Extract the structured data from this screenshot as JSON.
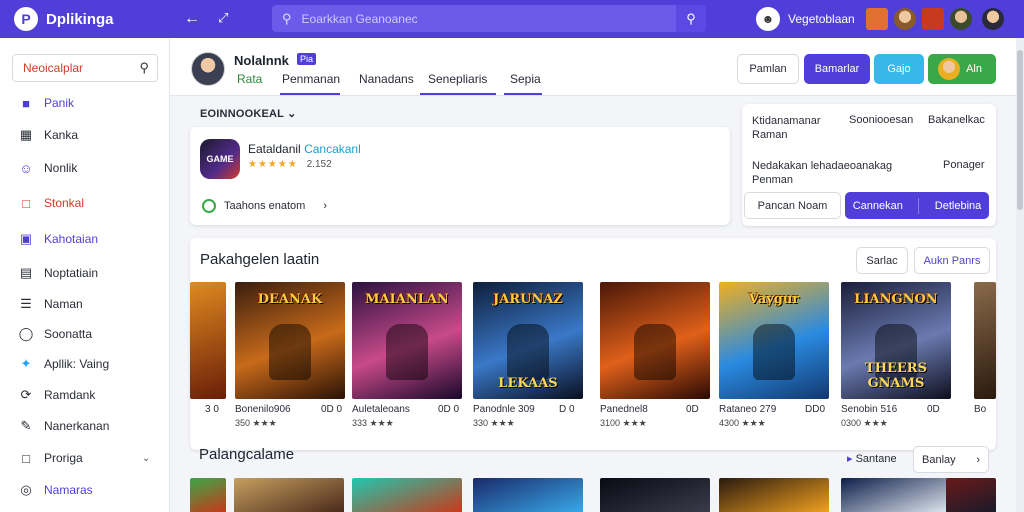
{
  "app": {
    "name": "Dplikinga"
  },
  "search": {
    "placeholder": "Eoarkkan Geanoanec"
  },
  "user": {
    "name": "Vegetoblaan"
  },
  "sidebar": {
    "search_label": "Neoicalplar",
    "items": [
      {
        "label": "Panik",
        "icon": "gamepad-icon"
      },
      {
        "label": "Kanka",
        "icon": "grid-icon"
      },
      {
        "label": "Nonlik",
        "icon": "user-icon"
      },
      {
        "label": "Stonkal",
        "icon": "flag-icon"
      },
      {
        "label": "Kahotaian",
        "icon": "shield-icon"
      },
      {
        "label": "Noptatiain",
        "icon": "list-icon"
      },
      {
        "label": "Naman",
        "icon": "menu-icon"
      },
      {
        "label": "Soonatta",
        "icon": "coin-icon"
      },
      {
        "label": "Apllik: Vaing",
        "icon": "bird-icon"
      },
      {
        "label": "Ramdank",
        "icon": "refresh-icon"
      },
      {
        "label": "Nanerkanan",
        "icon": "pencil-icon"
      },
      {
        "label": "Proriga",
        "icon": "doc-icon"
      },
      {
        "label": "Namaras",
        "icon": "globe-icon"
      }
    ]
  },
  "profile": {
    "name": "Nolalnnk",
    "badge": "Pia",
    "tabs": [
      "Rata",
      "Penmanan",
      "Nanadans",
      "Senepliaris",
      "Sepia"
    ]
  },
  "header_buttons": [
    "Pamlan",
    "Bamarlar",
    "Gajo",
    "Aln"
  ],
  "section": {
    "title": "EOINNOOKEAL"
  },
  "featured": {
    "app_title": "Eataldanil",
    "app_title_accent": "Cancakanl",
    "rating": "★★★★★",
    "rating_value": "2.152",
    "link_text": "Taahons enatom"
  },
  "side_panel": {
    "row1": [
      "Ktidanamanar",
      "Raman",
      "Sooniooesan",
      "Bakanelkac"
    ],
    "row2": [
      "Nedakakan lehadaeoanakag",
      "Penman",
      "Ponager"
    ],
    "btn1": "Pancan Noam",
    "btn2a": "Cannekan",
    "btn2b": "Detlebina"
  },
  "games_section": {
    "title": "Pakahgelen laatin",
    "btn_a": "Sarlac",
    "btn_b": "Aukn Panrs",
    "games": [
      {
        "art_top": "DEANAK",
        "art_bottom": "",
        "name": "Bonenilo906",
        "price": "0D 0",
        "rating_text": "350 ★★★",
        "colors": [
          "#3a1e0e",
          "#c86a1a",
          "#2a1206"
        ]
      },
      {
        "art_top": "MAIANLAN",
        "art_bottom": "",
        "name": "Auletaleoans",
        "price": "0D 0",
        "rating_text": "333 ★★★",
        "colors": [
          "#2b1240",
          "#c84a8a",
          "#18082a"
        ]
      },
      {
        "art_top": "JARUNAZ",
        "art_bottom": "LEKAAS",
        "name": "Panodnle 309",
        "price": "D 0",
        "rating_text": "330 ★★★",
        "colors": [
          "#0e1e3a",
          "#3a78c8",
          "#0a0f1f"
        ]
      },
      {
        "art_top": "",
        "art_bottom": "",
        "name": "Panednel8",
        "price": "0D",
        "rating_text": "3100 ★★★",
        "colors": [
          "#4a1808",
          "#e0601a",
          "#2a0a04"
        ]
      },
      {
        "art_top": "Vaygur",
        "art_bottom": "",
        "name": "Rataneo 279",
        "price": "DD0",
        "rating_text": "4300 ★★★",
        "colors": [
          "#f0b020",
          "#2a8ae0",
          "#123870"
        ]
      },
      {
        "art_top": "LIANGNON",
        "art_bottom": "THEERS GNAMS",
        "name": "Senobin 516",
        "price": "0D",
        "rating_text": "0300 ★★★",
        "colors": [
          "#1a1e3a",
          "#6a7ab0",
          "#0e0f1e"
        ]
      }
    ]
  },
  "second_section": {
    "title": "Palangcalame",
    "link": "Santane",
    "btn": "Banlay"
  }
}
